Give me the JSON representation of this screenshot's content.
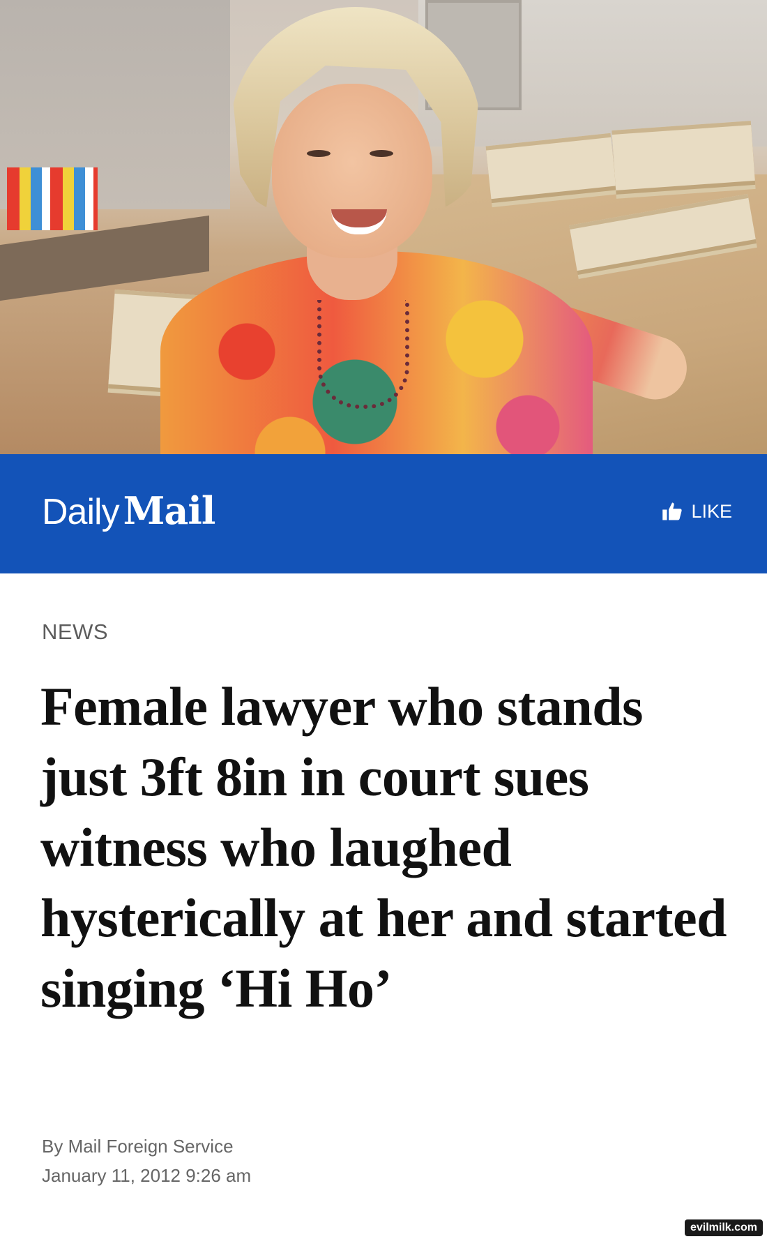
{
  "hero": {
    "alt": "Photo of a smiling woman with blonde hair in a colorful top, seated at a desk covered with stacks of legal files"
  },
  "header": {
    "logo_daily": "Daily",
    "logo_mail": "Mail",
    "like_label": "LIKE",
    "like_icon": "thumbs-up-icon",
    "bar_color": "#1353b8"
  },
  "article": {
    "section": "NEWS",
    "headline": "Female lawyer who stands just 3ft 8in in court sues witness who laughed hysterically at her and started singing ‘Hi Ho’",
    "byline": "By Mail Foreign Service",
    "date": "January 11, 2012 9:26 am"
  },
  "watermark": "evilmilk.com"
}
